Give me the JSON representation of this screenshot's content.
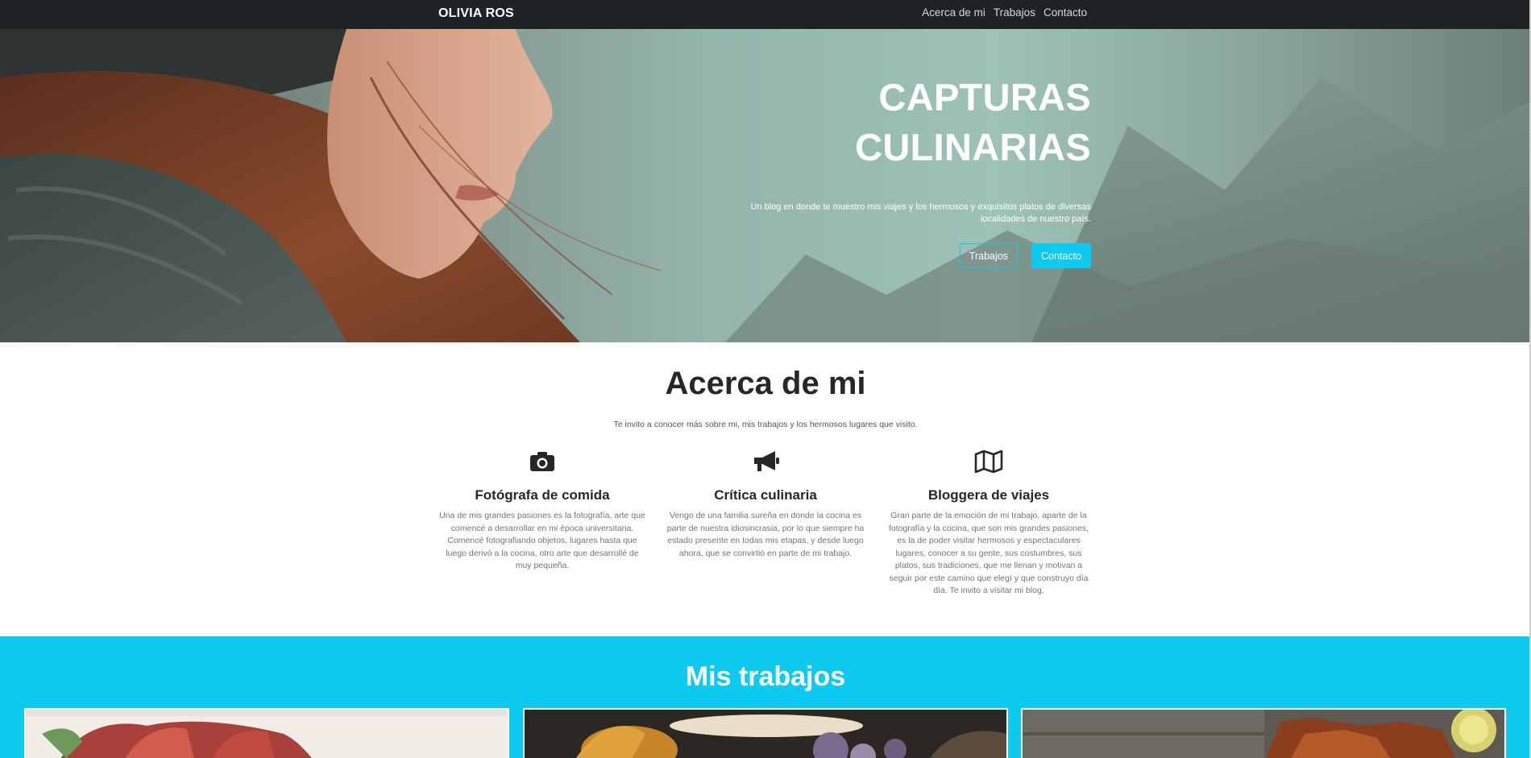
{
  "navbar": {
    "brand": "OLIVIA ROS",
    "links": [
      "Acerca de mi",
      "Trabajos",
      "Contacto"
    ]
  },
  "hero": {
    "title_line1": "CAPTURAS",
    "title_line2": "CULINARIAS",
    "subtitle": "Un blog en donde te muestro mis viajes y los hermosos y exquisitos platos de diversas localidades de nuestro país.",
    "button_works": "Trabajos",
    "button_contact": "Contacto"
  },
  "about": {
    "title": "Acerca de mi",
    "lead": "Te invito a conocer más sobre mi, mis trabajos y los hermosos lugares que visito.",
    "features": [
      {
        "icon": "camera-icon",
        "title": "Fotógrafa de comida",
        "text": "Una de mis grandes pasiones es la fotografía, arte que comencé a desarrollar en mi época universitaria. Comencé fotografiando objetos, lugares hasta que luego derivó a la cocina, otro arte que desarrollé de muy pequeña."
      },
      {
        "icon": "megaphone-icon",
        "title": "Crítica culinaria",
        "text": "Vengo de una familia sureña en donde la cocina es parte de nuestra idiosincrasia, por lo que siempre ha estado presente en todas mis etapas, y desde luego ahora, que se convirtió en parte de mi trabajo."
      },
      {
        "icon": "map-icon",
        "title": "Bloggera de viajes",
        "text": "Gran parte de la emoción de mi trabajo, aparte de la fotografía y la cocina, que son mis grandes pasiones, es la de poder visitar hermosos y espectaculares lugares, conocer a su gente, sus costumbres, sus platos, sus tradiciones, que me llenan y motivan a seguir por este camino que elegí y que construyo día día. Te invito a visitar mi blog."
      }
    ]
  },
  "works": {
    "title": "Mis trabajos"
  },
  "colors": {
    "accent": "#0dcaf0",
    "navbar": "#1f2225"
  }
}
